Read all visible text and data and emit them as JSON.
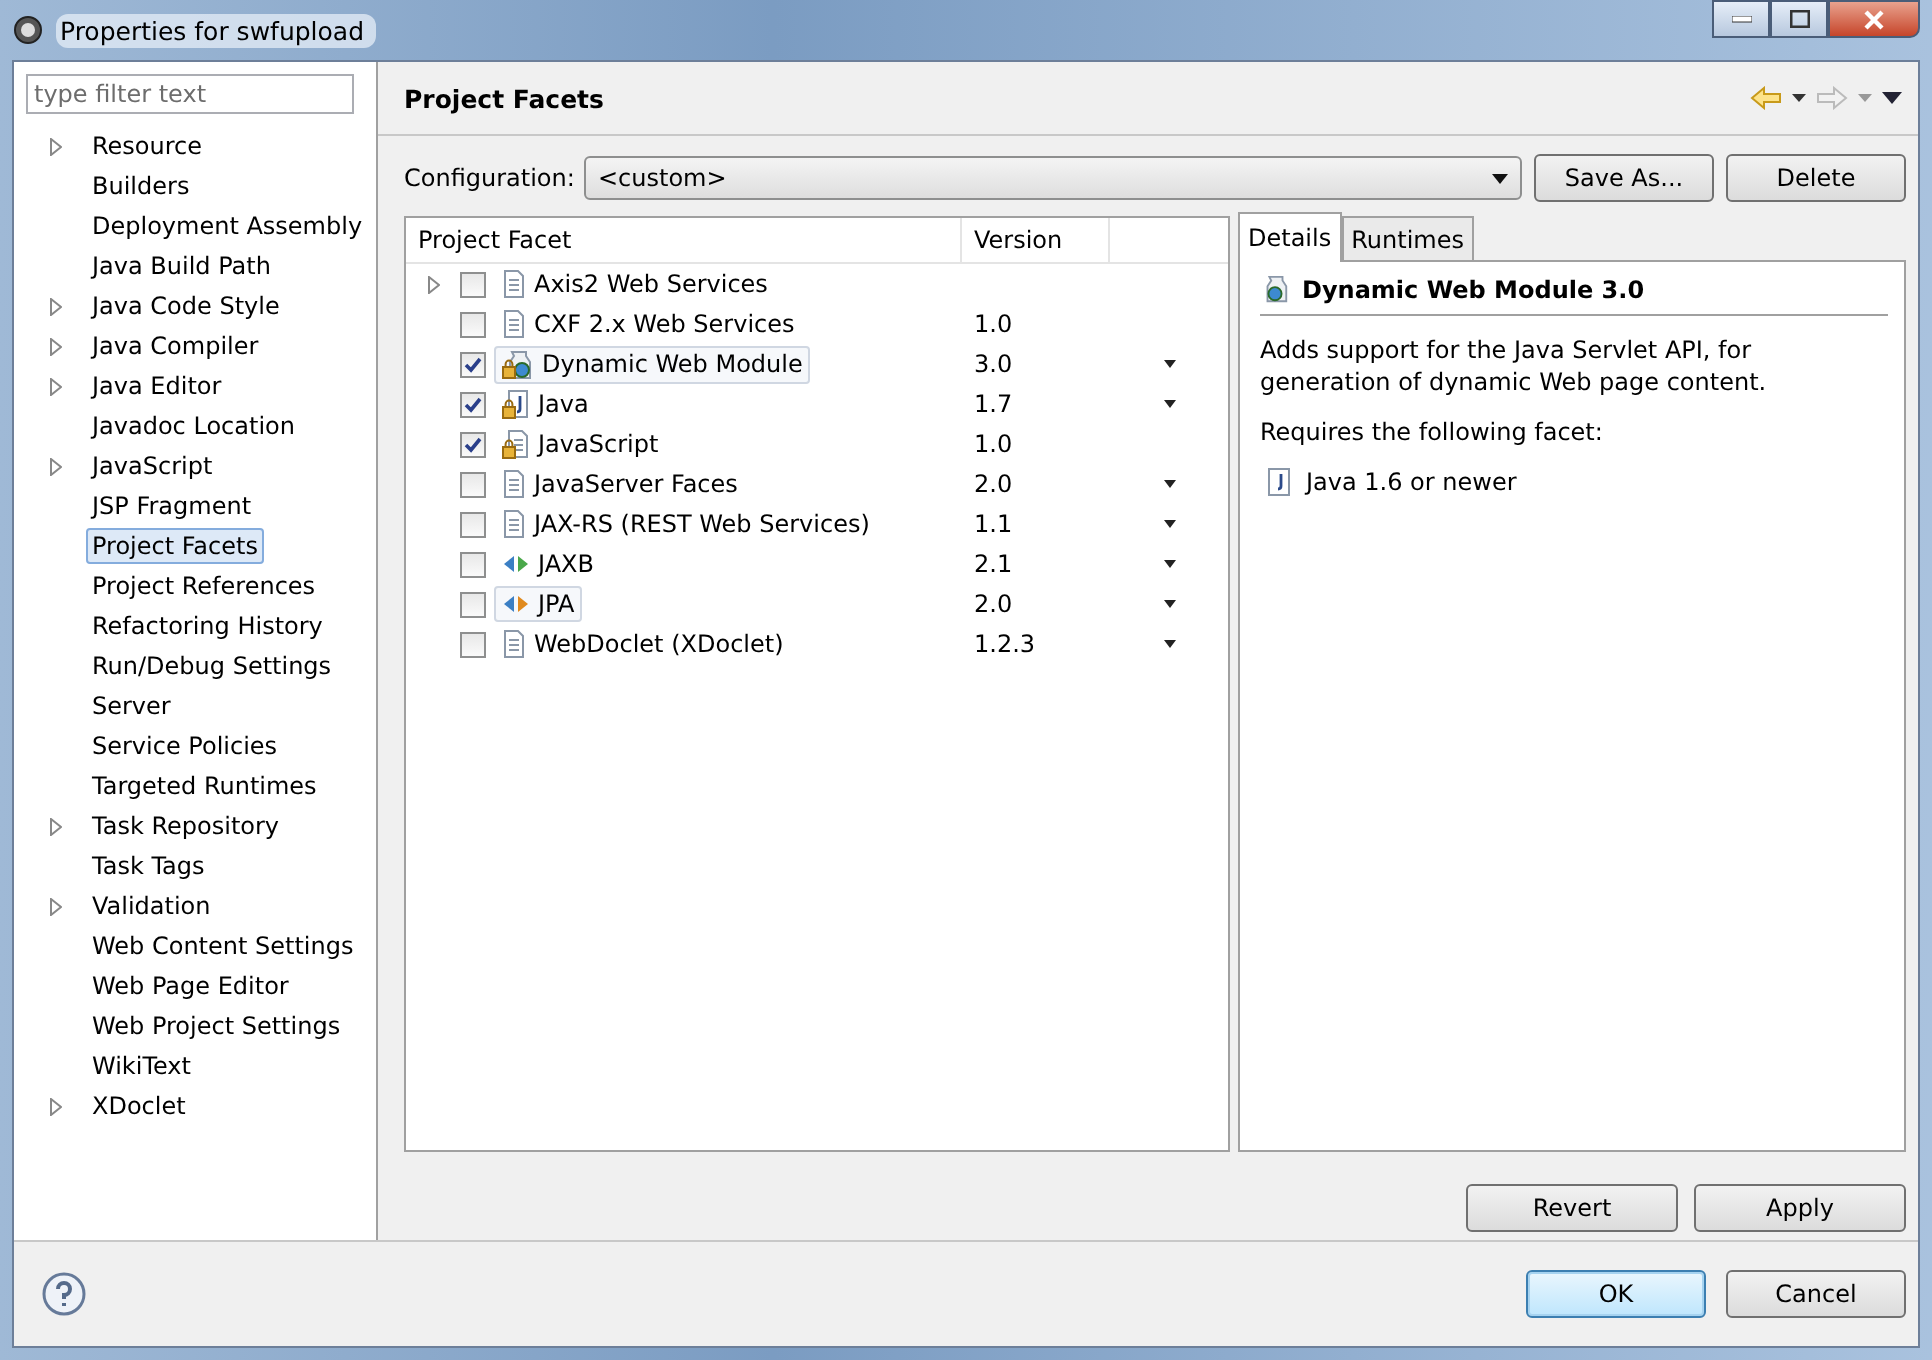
{
  "window": {
    "title": "Properties for swfupload"
  },
  "sidebar": {
    "filter": {
      "placeholder": "type filter text"
    },
    "items": [
      {
        "label": "Resource",
        "expandable": true,
        "selected": false
      },
      {
        "label": "Builders",
        "expandable": false,
        "selected": false
      },
      {
        "label": "Deployment Assembly",
        "expandable": false,
        "selected": false
      },
      {
        "label": "Java Build Path",
        "expandable": false,
        "selected": false
      },
      {
        "label": "Java Code Style",
        "expandable": true,
        "selected": false
      },
      {
        "label": "Java Compiler",
        "expandable": true,
        "selected": false
      },
      {
        "label": "Java Editor",
        "expandable": true,
        "selected": false
      },
      {
        "label": "Javadoc Location",
        "expandable": false,
        "selected": false
      },
      {
        "label": "JavaScript",
        "expandable": true,
        "selected": false
      },
      {
        "label": "JSP Fragment",
        "expandable": false,
        "selected": false
      },
      {
        "label": "Project Facets",
        "expandable": false,
        "selected": true
      },
      {
        "label": "Project References",
        "expandable": false,
        "selected": false
      },
      {
        "label": "Refactoring History",
        "expandable": false,
        "selected": false
      },
      {
        "label": "Run/Debug Settings",
        "expandable": false,
        "selected": false
      },
      {
        "label": "Server",
        "expandable": false,
        "selected": false
      },
      {
        "label": "Service Policies",
        "expandable": false,
        "selected": false
      },
      {
        "label": "Targeted Runtimes",
        "expandable": false,
        "selected": false
      },
      {
        "label": "Task Repository",
        "expandable": true,
        "selected": false
      },
      {
        "label": "Task Tags",
        "expandable": false,
        "selected": false
      },
      {
        "label": "Validation",
        "expandable": true,
        "selected": false
      },
      {
        "label": "Web Content Settings",
        "expandable": false,
        "selected": false
      },
      {
        "label": "Web Page Editor",
        "expandable": false,
        "selected": false
      },
      {
        "label": "Web Project Settings",
        "expandable": false,
        "selected": false
      },
      {
        "label": "WikiText",
        "expandable": false,
        "selected": false
      },
      {
        "label": "XDoclet",
        "expandable": true,
        "selected": false
      }
    ]
  },
  "page": {
    "title": "Project Facets",
    "configuration": {
      "label": "Configuration:",
      "value": "<custom>"
    },
    "config_buttons": [
      "Save As...",
      "Delete"
    ],
    "table": {
      "columns": [
        "Project Facet",
        "Version"
      ],
      "rows": [
        {
          "name": "Axis2 Web Services",
          "version": "",
          "kind": "document",
          "expandable": true,
          "checked": false,
          "dropdown": false,
          "highlighted": false
        },
        {
          "name": "CXF 2.x Web Services",
          "version": "1.0",
          "kind": "document",
          "expandable": false,
          "checked": false,
          "dropdown": false,
          "highlighted": false
        },
        {
          "name": "Dynamic Web Module",
          "version": "3.0",
          "kind": "web-module",
          "expandable": false,
          "checked": true,
          "dropdown": true,
          "highlighted": true
        },
        {
          "name": "Java",
          "version": "1.7",
          "kind": "java",
          "expandable": false,
          "checked": true,
          "dropdown": true,
          "highlighted": false
        },
        {
          "name": "JavaScript",
          "version": "1.0",
          "kind": "locked-document",
          "expandable": false,
          "checked": true,
          "dropdown": false,
          "highlighted": false
        },
        {
          "name": "JavaServer Faces",
          "version": "2.0",
          "kind": "document",
          "expandable": false,
          "checked": false,
          "dropdown": true,
          "highlighted": false
        },
        {
          "name": "JAX-RS (REST Web Services)",
          "version": "1.1",
          "kind": "document",
          "expandable": false,
          "checked": false,
          "dropdown": true,
          "highlighted": false
        },
        {
          "name": "JAXB",
          "version": "2.1",
          "kind": "arrows-green",
          "expandable": false,
          "checked": false,
          "dropdown": true,
          "highlighted": false
        },
        {
          "name": "JPA",
          "version": "2.0",
          "kind": "arrows-orange",
          "expandable": false,
          "checked": false,
          "dropdown": true,
          "highlighted": true
        },
        {
          "name": "WebDoclet (XDoclet)",
          "version": "1.2.3",
          "kind": "document",
          "expandable": false,
          "checked": false,
          "dropdown": true,
          "highlighted": false
        }
      ]
    },
    "tabs": [
      {
        "label": "Details",
        "selected": true
      },
      {
        "label": "Runtimes",
        "selected": false
      }
    ],
    "details": {
      "title": "Dynamic Web Module 3.0",
      "description": "Adds support for the Java Servlet API, for generation of dynamic Web page content.",
      "requires_label": "Requires the following facet:",
      "requirements": [
        "Java 1.6 or newer"
      ]
    },
    "page_buttons": [
      "Revert",
      "Apply"
    ]
  },
  "dialog_buttons": [
    {
      "label": "OK",
      "default": true
    },
    {
      "label": "Cancel",
      "default": false
    }
  ]
}
